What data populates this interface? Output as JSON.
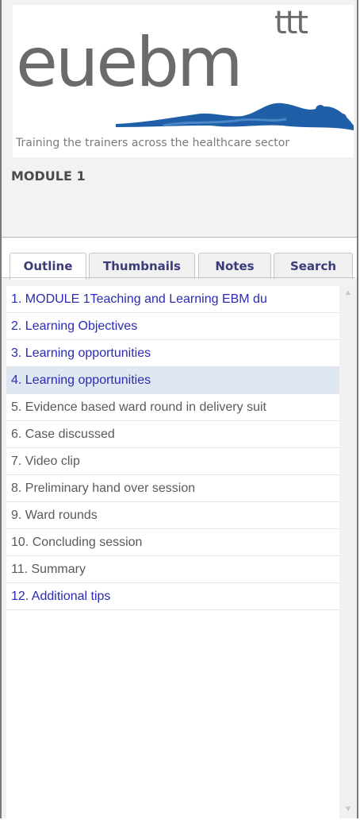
{
  "logo": {
    "main_text": "euebm",
    "superscript": "ttt",
    "tagline": "Training the trainers across the healthcare sector"
  },
  "module_title": "MODULE 1",
  "tabs": [
    {
      "label": "Outline",
      "active": true
    },
    {
      "label": "Thumbnails",
      "active": false
    },
    {
      "label": "Notes",
      "active": false
    },
    {
      "label": "Search",
      "active": false
    }
  ],
  "outline": {
    "items": [
      {
        "label": "1. MODULE 1Teaching and Learning EBM du",
        "style": "linked",
        "selected": false
      },
      {
        "label": "2. Learning Objectives",
        "style": "linked",
        "selected": false
      },
      {
        "label": "3. Learning opportunities",
        "style": "linked",
        "selected": false
      },
      {
        "label": "4. Learning opportunities",
        "style": "linked",
        "selected": true
      },
      {
        "label": "5. Evidence based ward round in delivery suit",
        "style": "plain",
        "selected": false
      },
      {
        "label": "6. Case discussed",
        "style": "plain",
        "selected": false
      },
      {
        "label": "7. Video clip",
        "style": "plain",
        "selected": false
      },
      {
        "label": "8. Preliminary hand over session",
        "style": "plain",
        "selected": false
      },
      {
        "label": "9. Ward rounds",
        "style": "plain",
        "selected": false
      },
      {
        "label": "10. Concluding session",
        "style": "plain",
        "selected": false
      },
      {
        "label": "11. Summary",
        "style": "plain",
        "selected": false
      },
      {
        "label": "12. Additional tips",
        "style": "linked",
        "selected": false
      }
    ]
  },
  "colors": {
    "link": "#2b2bb5",
    "plain": "#5a5a5a",
    "selected_bg": "#dfe7f2",
    "logo_blue": "#1f5fa8"
  },
  "icons": {
    "scroll_up": "triangle-up-icon",
    "scroll_down": "triangle-down-icon"
  }
}
